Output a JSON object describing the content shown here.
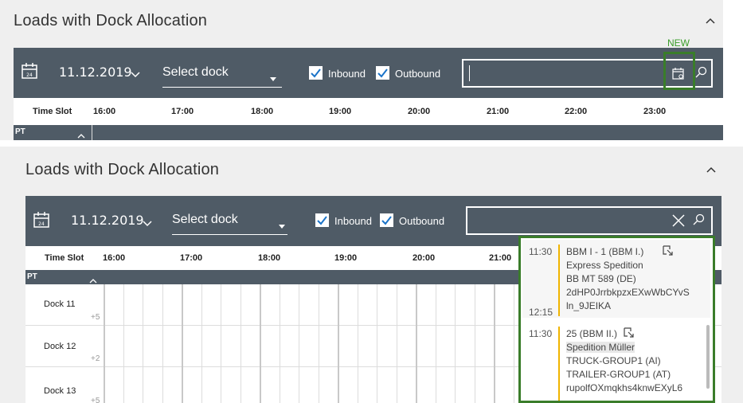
{
  "panel_top": {
    "title": "Loads with Dock Allocation",
    "date": "11.12.2019",
    "dock_select": "Select dock",
    "inbound_label": "Inbound",
    "outbound_label": "Outbound",
    "new_label": "NEW",
    "timeslot_label": "Time Slot",
    "times": [
      "16:00",
      "17:00",
      "18:00",
      "19:00",
      "20:00",
      "21:00",
      "22:00",
      "23:00"
    ],
    "pt_label": "PT"
  },
  "panel_bottom": {
    "title": "Loads with Dock Allocation",
    "date": "11.12.2019",
    "dock_select": "Select dock",
    "inbound_label": "Inbound",
    "outbound_label": "Outbound",
    "timeslot_label": "Time Slot",
    "times": [
      "16:00",
      "17:00",
      "18:00",
      "19:00",
      "20:00",
      "21:00"
    ],
    "pt_label": "PT",
    "docks": [
      {
        "name": "Dock 11",
        "count": "+5"
      },
      {
        "name": "Dock 12",
        "count": "+2"
      },
      {
        "name": "Dock 13",
        "count": "+5"
      }
    ],
    "results": [
      {
        "start": "11:30",
        "end": "12:15",
        "lines": [
          "BBM I - 1 (BBM I.)",
          "Express Spedition",
          "BB MT 589 (DE)",
          "2dHP0JrrbkpzxEXwWbCYvS",
          "ln_9JEIKA"
        ]
      },
      {
        "start": "11:30",
        "lines": [
          "25 (BBM II.)",
          "Spedition Müller",
          "TRUCK-GROUP1  (AI)",
          "TRAILER-GROUP1  (AT)",
          "rupolfOXmqkhs4knwEXyL6"
        ]
      }
    ]
  },
  "colors": {
    "toolbar": "#4f5b66",
    "highlight": "#3a7d2a",
    "accent_bar": "#f0b400",
    "checkbox": "#1a73c8"
  }
}
